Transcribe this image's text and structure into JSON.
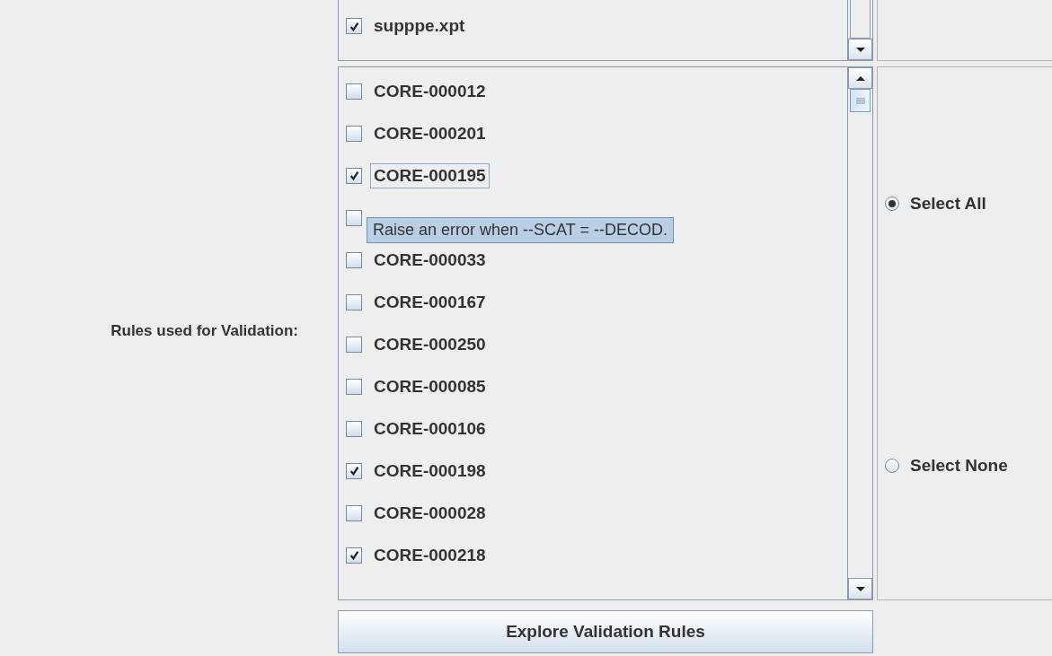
{
  "files": {
    "items": [
      {
        "label": "supppe.xpt",
        "checked": true
      }
    ]
  },
  "rules": {
    "label": "Rules used for Validation:",
    "items": [
      {
        "label": "CORE-000012",
        "checked": false,
        "focused": false
      },
      {
        "label": "CORE-000201",
        "checked": false,
        "focused": false
      },
      {
        "label": "CORE-000195",
        "checked": true,
        "focused": true
      },
      {
        "checked": false,
        "focused": false
      },
      {
        "label": "CORE-000033",
        "checked": false,
        "focused": false
      },
      {
        "label": "CORE-000167",
        "checked": false,
        "focused": false
      },
      {
        "label": "CORE-000250",
        "checked": false,
        "focused": false
      },
      {
        "label": "CORE-000085",
        "checked": false,
        "focused": false
      },
      {
        "label": "CORE-000106",
        "checked": false,
        "focused": false
      },
      {
        "label": "CORE-000198",
        "checked": true,
        "focused": false
      },
      {
        "label": "CORE-000028",
        "checked": false,
        "focused": false
      },
      {
        "label": "CORE-000218",
        "checked": true,
        "focused": false
      }
    ],
    "tooltip": "Raise an error when --SCAT = --DECOD.",
    "options": [
      {
        "label": "Select All",
        "selected": true
      },
      {
        "label": "Select None",
        "selected": false
      }
    ],
    "button": "Explore Validation Rules"
  }
}
